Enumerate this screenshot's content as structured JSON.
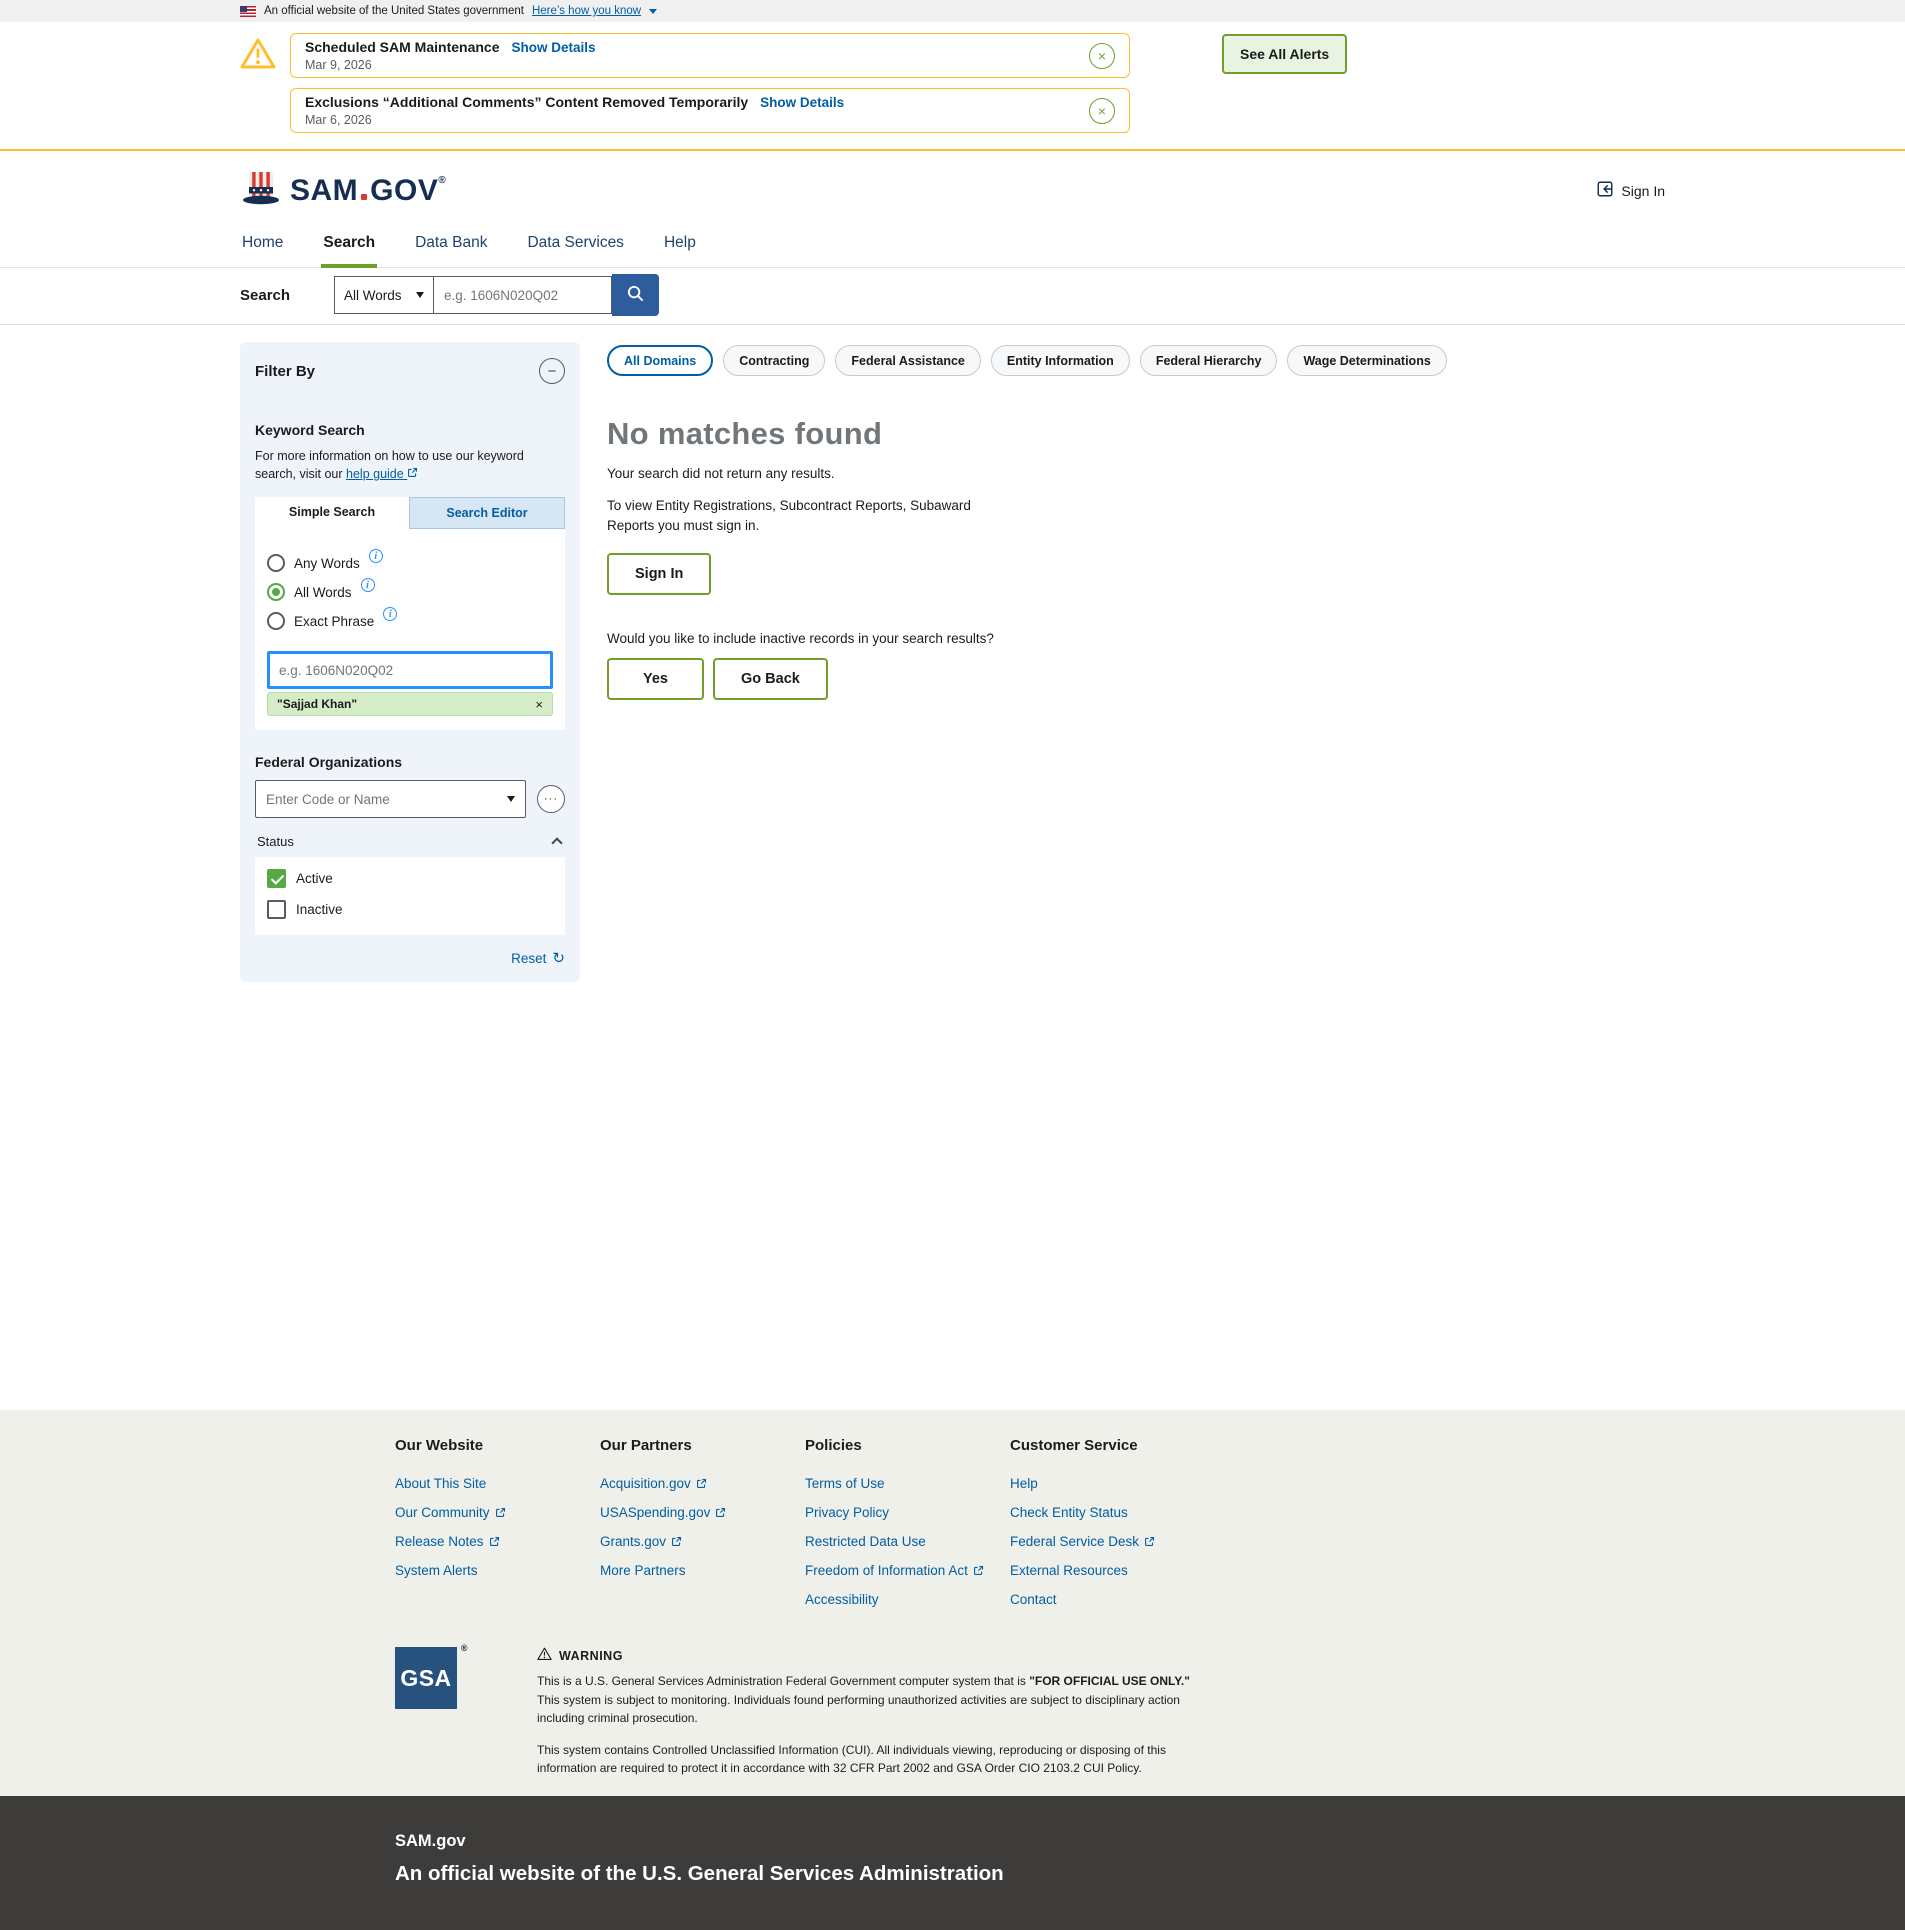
{
  "colors": {
    "accent_green": "#719f2a",
    "primary_blue": "#005ea2",
    "alert_gold": "#ffbe2e",
    "search_button_blue": "#2e5d9e",
    "focus_blue": "#2491ff",
    "checkbox_green": "#56a944"
  },
  "icons": {
    "close": "×",
    "minus": "−",
    "ellipsis": "···",
    "reset": "↻",
    "info": "i"
  },
  "gov_banner": {
    "text": "An official website of the United States government",
    "link": "Here’s how you know"
  },
  "alerts": {
    "items": [
      {
        "title": "Scheduled SAM Maintenance",
        "details": "Show Details",
        "date": "Mar 9, 2026"
      },
      {
        "title": "Exclusions “Additional Comments” Content Removed Temporarily",
        "details": "Show Details",
        "date": "Mar 6, 2026"
      }
    ],
    "see_all": "See All Alerts"
  },
  "header": {
    "brand_sam": "SAM",
    "brand_gov": "GOV",
    "brand_reg": "®",
    "sign_in": "Sign In"
  },
  "nav": {
    "items": [
      {
        "label": "Home"
      },
      {
        "label": "Search",
        "active": true
      },
      {
        "label": "Data Bank"
      },
      {
        "label": "Data Services"
      },
      {
        "label": "Help"
      }
    ]
  },
  "searchbar": {
    "label": "Search",
    "mode": "All Words",
    "placeholder": "e.g. 1606N020Q02"
  },
  "filter": {
    "title": "Filter By",
    "keyword_heading": "Keyword Search",
    "keyword_help_pre": "For more information on how to use our keyword search, visit our",
    "keyword_help_link": "help guide",
    "tabs": [
      {
        "label": "Simple Search",
        "active": true
      },
      {
        "label": "Search Editor",
        "active": false
      }
    ],
    "radio_any": "Any Words",
    "radio_all": "All Words",
    "radio_exact": "Exact Phrase",
    "radio_selected": "All Words",
    "keyword_placeholder": "e.g. 1606N020Q02",
    "chip": "\"Sajjad Khan\"",
    "fed_org_heading": "Federal Organizations",
    "fed_org_placeholder": "Enter Code or Name",
    "status_heading": "Status",
    "status_active": "Active",
    "status_active_checked": true,
    "status_inactive": "Inactive",
    "status_inactive_checked": false,
    "reset": "Reset"
  },
  "results": {
    "domains": [
      {
        "label": "All Domains",
        "active": true
      },
      {
        "label": "Contracting"
      },
      {
        "label": "Federal Assistance"
      },
      {
        "label": "Entity Information"
      },
      {
        "label": "Federal Hierarchy"
      },
      {
        "label": "Wage Determinations"
      }
    ],
    "title": "No matches found",
    "subtitle": "Your search did not return any results.",
    "signin_note": "To view Entity Registrations, Subcontract Reports, Subaward Reports you must sign in.",
    "signin_button": "Sign In",
    "inactive_question": "Would you like to include inactive records in your search results?",
    "yes_button": "Yes",
    "goback_button": "Go Back"
  },
  "footer": {
    "columns": [
      {
        "heading": "Our Website",
        "links": [
          {
            "label": "About This Site",
            "external": false
          },
          {
            "label": "Our Community",
            "external": true
          },
          {
            "label": "Release Notes",
            "external": true
          },
          {
            "label": "System Alerts",
            "external": false
          }
        ]
      },
      {
        "heading": "Our Partners",
        "links": [
          {
            "label": "Acquisition.gov",
            "external": true
          },
          {
            "label": "USASpending.gov",
            "external": true
          },
          {
            "label": "Grants.gov",
            "external": true
          },
          {
            "label": "More Partners",
            "external": false
          }
        ]
      },
      {
        "heading": "Policies",
        "links": [
          {
            "label": "Terms of Use",
            "external": false
          },
          {
            "label": "Privacy Policy",
            "external": false
          },
          {
            "label": "Restricted Data Use",
            "external": false
          },
          {
            "label": "Freedom of Information Act",
            "external": true
          },
          {
            "label": "Accessibility",
            "external": false
          }
        ]
      },
      {
        "heading": "Customer Service",
        "links": [
          {
            "label": "Help",
            "external": false
          },
          {
            "label": "Check Entity Status",
            "external": false
          },
          {
            "label": "Federal Service Desk",
            "external": true
          },
          {
            "label": "External Resources",
            "external": false
          },
          {
            "label": "Contact",
            "external": false
          }
        ]
      }
    ],
    "gsa": "GSA",
    "gsa_reg": "®",
    "warning_heading": "WARNING",
    "warning_p1_pre": "This is a U.S. General Services Administration Federal Government computer system that is ",
    "warning_p1_bold": "\"FOR OFFICIAL USE ONLY.\"",
    "warning_p1_post": " This system is subject to monitoring. Individuals found performing unauthorized activities are subject to disciplinary action including criminal prosecution.",
    "warning_p2": "This system contains Controlled Unclassified Information (CUI). All individuals viewing, reproducing or disposing of this information are required to protect it in accordance with 32 CFR Part 2002 and GSA Order CIO 2103.2 CUI Policy."
  },
  "site_footer": {
    "brand": "SAM.gov",
    "tagline": "An official website of the U.S. General Services Administration"
  }
}
